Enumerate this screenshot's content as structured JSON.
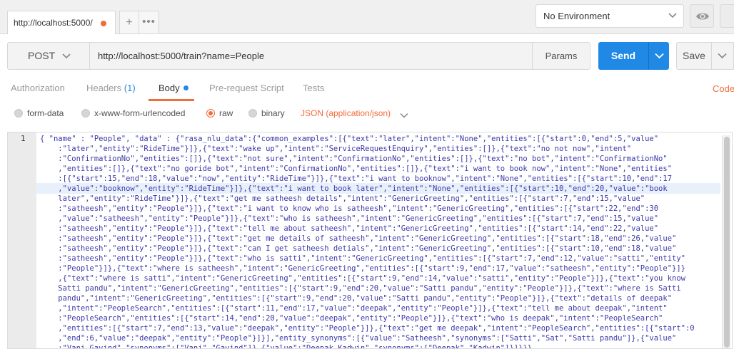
{
  "tab": {
    "title": "http://localhost:5000/",
    "add_label": "+",
    "more_label": "•••"
  },
  "environment": {
    "selected": "No Environment"
  },
  "request": {
    "method": "POST",
    "url": "http://localhost:5000/train?name=People",
    "params_label": "Params",
    "send_label": "Send",
    "save_label": "Save"
  },
  "req_tabs": {
    "authorization": "Authorization",
    "headers": "Headers",
    "headers_count": "(1)",
    "body": "Body",
    "prerequest": "Pre-request Script",
    "tests": "Tests",
    "code": "Code"
  },
  "body_types": {
    "form_data": "form-data",
    "urlencoded": "x-www-form-urlencoded",
    "raw": "raw",
    "binary": "binary",
    "content_type": "JSON (application/json)"
  },
  "editor": {
    "line_number": "1",
    "lines": [
      "{ \"name\" : \"People\", \"data\" : {\"rasa_nlu_data\":{\"common_examples\":[{\"text\":\"later\",\"intent\":\"None\",\"entities\":[{\"start\":0,\"end\":5,\"value\"",
      "    :\"later\",\"entity\":\"RideTime\"}]},{\"text\":\"wake up\",\"intent\":\"ServiceRequestEnquiry\",\"entities\":[]},{\"text\":\"no not now\",\"intent\"",
      "    :\"ConfirmationNo\",\"entities\":[]},{\"text\":\"not sure\",\"intent\":\"ConfirmationNo\",\"entities\":[]},{\"text\":\"no bot\",\"intent\":\"ConfirmationNo\"",
      "    ,\"entities\":[]},{\"text\":\"no goride bot\",\"intent\":\"ConfirmationNo\",\"entities\":[]},{\"text\":\"i want to book now\",\"intent\":\"None\",\"entities\"",
      "    :[{\"start\":15,\"end\":18,\"value\":\"now\",\"entity\":\"RideTime\"}]},{\"text\":\"i want to booknow\",\"intent\":\"None\",\"entities\":[{\"start\":10,\"end\":17",
      "    ,\"value\":\"booknow\",\"entity\":\"RideTime\"}]},{\"text\":\"i want to book later\",\"intent\":\"None\",\"entities\":[{\"start\":10,\"end\":20,\"value\":\"book",
      "    later\",\"entity\":\"RideTime\"}]},{\"text\":\"get me satheesh details\",\"intent\":\"GenericGreeting\",\"entities\":[{\"start\":7,\"end\":15,\"value\"",
      "    :\"satheesh\",\"entity\":\"People\"}]},{\"text\":\"i want to know who is satheesh\",\"intent\":\"GenericGreeting\",\"entities\":[{\"start\":22,\"end\":30",
      "    ,\"value\":\"satheesh\",\"entity\":\"People\"}]},{\"text\":\"who is satheesh\",\"intent\":\"GenericGreeting\",\"entities\":[{\"start\":7,\"end\":15,\"value\"",
      "    :\"satheesh\",\"entity\":\"People\"}]},{\"text\":\"tell me about satheesh\",\"intent\":\"GenericGreeting\",\"entities\":[{\"start\":14,\"end\":22,\"value\"",
      "    :\"satheesh\",\"entity\":\"People\"}]},{\"text\":\"get me details of satheesh\",\"intent\":\"GenericGreeting\",\"entities\":[{\"start\":18,\"end\":26,\"value\"",
      "    :\"satheesh\",\"entity\":\"People\"}]},{\"text\":\"can I get satheesh detials\",\"intent\":\"GenericGreeting\",\"entities\":[{\"start\":10,\"end\":18,\"value\"",
      "    :\"satheesh\",\"entity\":\"People\"}]},{\"text\":\"who is satti\",\"intent\":\"GenericGreeting\",\"entities\":[{\"start\":7,\"end\":12,\"value\":\"satti\",\"entity\"",
      "    :\"People\"}]},{\"text\":\"where is satheesh\",\"intent\":\"GenericGreeting\",\"entities\":[{\"start\":9,\"end\":17,\"value\":\"satheesh\",\"entity\":\"People\"}]}",
      "    ,{\"text\":\"where is satti\",\"intent\":\"GenericGreeting\",\"entities\":[{\"start\":9,\"end\":14,\"value\":\"satti\",\"entity\":\"People\"}]},{\"text\":\"you know",
      "    Satti pandu\",\"intent\":\"GenericGreeting\",\"entities\":[{\"start\":9,\"end\":20,\"value\":\"Satti pandu\",\"entity\":\"People\"}]},{\"text\":\"where is Satti",
      "    pandu\",\"intent\":\"GenericGreeting\",\"entities\":[{\"start\":9,\"end\":20,\"value\":\"Satti pandu\",\"entity\":\"People\"}]},{\"text\":\"details of deepak\"",
      "    ,\"intent\":\"PeopleSearch\",\"entities\":[{\"start\":11,\"end\":17,\"value\":\"deepak\",\"entity\":\"People\"}]},{\"text\":\"tell me about deepak\",\"intent\"",
      "    :\"PeopleSearch\",\"entities\":[{\"start\":14,\"end\":20,\"value\":\"deepak\",\"entity\":\"People\"}]},{\"text\":\"who is deepak\",\"intent\":\"PeopleSearch\"",
      "    ,\"entities\":[{\"start\":7,\"end\":13,\"value\":\"deepak\",\"entity\":\"People\"}]},{\"text\":\"get me deepak\",\"intent\":\"PeopleSearch\",\"entities\":[{\"start\":0",
      "    ,\"end\":6,\"value\":\"deepak\",\"entity\":\"People\"}]}],\"entity_synonyms\":[{\"value\":\"Satheesh\",\"synonyms\":[\"Satti\",\"Sat\",\"Satti pandu\"]},{\"value\"",
      "    :\"Vani Gavind\",\"synonyms\":[\"Vani\",\"Gavind\"]},{\"value\":\"Deepak Kadwin\",\"synonyms\":[\"Deepak\",\"Kadwin\"]}]}}}"
    ]
  },
  "colors": {
    "accent": "#f26b3a",
    "primary": "#1f89e5",
    "code_text": "#3a3aa8"
  }
}
